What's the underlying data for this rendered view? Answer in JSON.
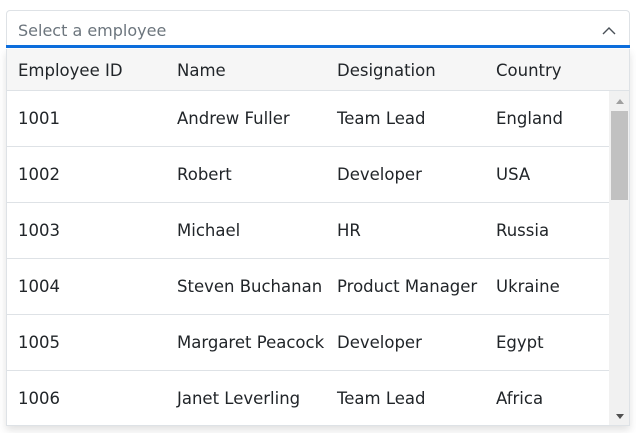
{
  "combo": {
    "placeholder": "Select a employee",
    "toggle_icon": "chevron-up-icon",
    "accent_color": "#0d6edd"
  },
  "grid": {
    "columns": [
      "Employee ID",
      "Name",
      "Designation",
      "Country"
    ],
    "rows": [
      [
        "1001",
        "Andrew Fuller",
        "Team Lead",
        "England"
      ],
      [
        "1002",
        "Robert",
        "Developer",
        "USA"
      ],
      [
        "1003",
        "Michael",
        "HR",
        "Russia"
      ],
      [
        "1004",
        "Steven Buchanan",
        "Product Manager",
        "Ukraine"
      ],
      [
        "1005",
        "Margaret Peacock",
        "Developer",
        "Egypt"
      ],
      [
        "1006",
        "Janet Leverling",
        "Team Lead",
        "Africa"
      ]
    ]
  },
  "scrollbar": {
    "up_icon": "triangle-up-icon",
    "down_icon": "triangle-down-icon"
  }
}
